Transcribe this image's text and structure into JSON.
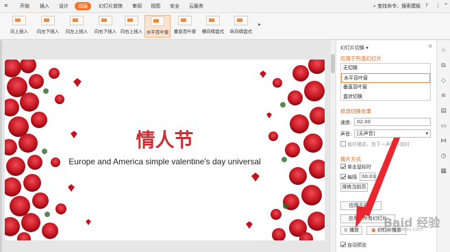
{
  "menu": {
    "start": "开始",
    "insert": "插入",
    "design": "设计",
    "animation": "动画",
    "slideshow": "幻灯片放映",
    "review": "审阅",
    "view": "视图",
    "security": "安全",
    "cloud": "云服务",
    "search": "查找命令、搜索模板"
  },
  "ribbon": {
    "items": [
      "向上插入",
      "向左下插入",
      "向左上插入",
      "向右下插入",
      "向右上插入",
      "水平百叶窗",
      "垂直百叶窗",
      "横向棋盘式",
      "纵向棋盘式"
    ]
  },
  "slide": {
    "title": "情人节",
    "subtitle": "Europe and America simple valentine's day universal"
  },
  "pane": {
    "header": "幻灯片切换",
    "apply_section": "应用于所选幻灯片",
    "effects": [
      "无切换",
      "水平百叶窗",
      "垂直百叶窗",
      "盒状切换"
    ],
    "modify_section": "修改切换效果",
    "speed_label": "速度:",
    "speed_value": "02.00",
    "sound_label": "声音:",
    "sound_value": "[无声音]",
    "loop_label": "循环播放，到下一声音开始时",
    "advance_section": "换片方式",
    "on_click": "单击鼠标时",
    "every": "每隔",
    "every_value": "00:03",
    "rehearse": "排练当前页",
    "apply_master": "应用于母版",
    "apply_all": "应用于所有幻灯片",
    "play": "播放",
    "slideshow": "幻灯片播放",
    "autopreview": "自动预览"
  },
  "watermark": {
    "line1": "Baid 经验",
    "line2": "jingyan.baidu.com"
  },
  "colors": {
    "accent": "#f3752c",
    "title": "#c62f36",
    "arrow": "#e8272e"
  }
}
